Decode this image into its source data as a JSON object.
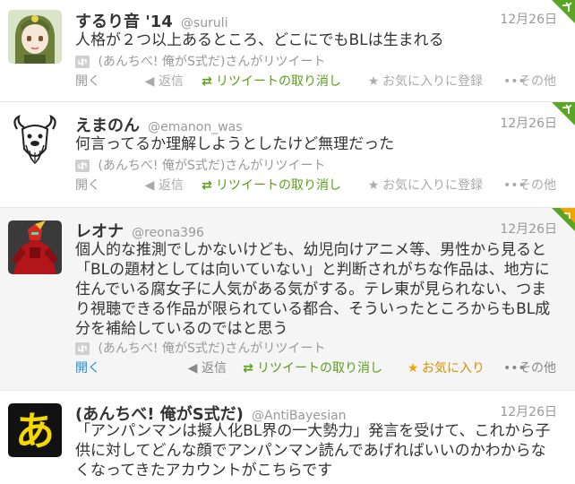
{
  "tweets": [
    {
      "name": "するり音 '14",
      "handle": "@suruli",
      "time": "12月26日",
      "text": "人格が２つ以上あるところ、どこにでもBLは生まれる",
      "retweeted_by": "(あんちべ! 俺がS式だ)さんがリツイート",
      "actions": {
        "open": "開く",
        "reply": "返信",
        "retweet": "リツイートの取り消し",
        "favorite": "お気に入りに登録",
        "more": "その他"
      },
      "corner_color": "#5aa526",
      "avatar": "anime-girl-avatar"
    },
    {
      "name": "えまのん",
      "handle": "@emanon_was",
      "time": "12月26日",
      "text": "何言ってるか理解しようとしたけど無理だった",
      "retweeted_by": "(あんちべ! 俺がS式だ)さんがリツイート",
      "actions": {
        "open": "開く",
        "reply": "返信",
        "retweet": "リツイートの取り消し",
        "favorite": "お気に入りに登録",
        "more": "その他"
      },
      "corner_color": "#5aa526",
      "avatar": "gnu-avatar"
    },
    {
      "name": "レオナ",
      "handle": "@reona396",
      "time": "12月26日",
      "text": "個人的な推測でしかないけども、幼児向けアニメ等、男性から見ると「BLの題材としては向いていない」と判断されがちな作品は、地方に住んでいる腐女子に人気がある気がする。テレ東が見られない、つまり視聴できる作品が限られている都合、そういったところからもBL成分を補給しているのではと思う",
      "retweeted_by": "(あんちべ! 俺がS式だ)さんがリツイート",
      "actions": {
        "open": "開く",
        "reply": "返信",
        "retweet": "リツイートの取り消し",
        "favorite": "お気に入り",
        "more": "その他"
      },
      "corner_color": "#f0a400",
      "avatar": "red-robot-avatar"
    },
    {
      "name": "(あんちべ! 俺がS式だ)",
      "handle": "@AntiBayesian",
      "time": "12月26日",
      "text": "「アンパンマンは擬人化BL界の一大勢力」発言を受けて、これから子供に対してどんな顔でアンパンマン読んであげればいいのかわからなくなってきたアカウントがこちらです",
      "avatar": "hiragana-a-avatar"
    }
  ],
  "colors": {
    "accent_blue": "#1f8ed1",
    "retweet_green": "#5b9e1b",
    "favorite_orange": "#f0a400",
    "muted_gray": "#999999"
  }
}
